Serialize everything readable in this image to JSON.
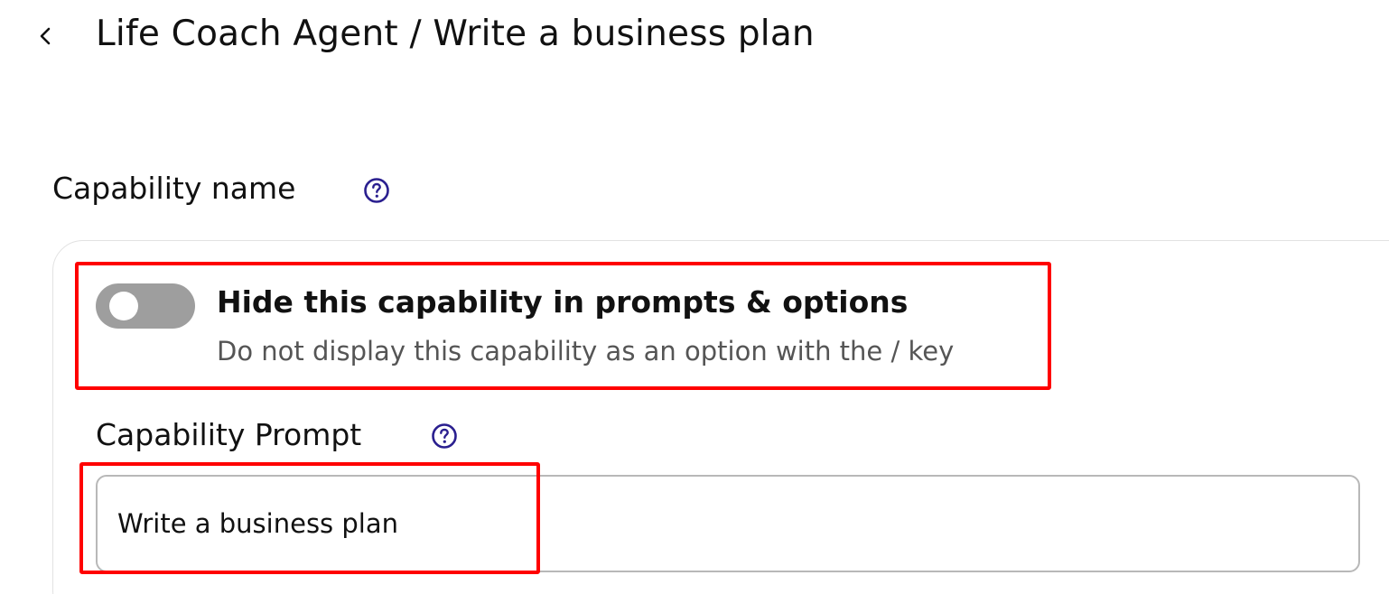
{
  "header": {
    "title": "Life Coach Agent / Write a business plan",
    "back_icon": "chevron-left-icon"
  },
  "capability_name": {
    "label": "Capability name",
    "help_icon": "question-circle-icon"
  },
  "hide_toggle": {
    "title": "Hide this capability in prompts & options",
    "description": "Do not display this capability as an option with the / key",
    "enabled": false
  },
  "capability_prompt": {
    "label": "Capability Prompt",
    "help_icon": "question-circle-icon",
    "value": "Write a business plan"
  },
  "colors": {
    "accent": "#2a1f8f",
    "highlight": "#ff0000",
    "toggle_off": "#9e9e9e"
  }
}
